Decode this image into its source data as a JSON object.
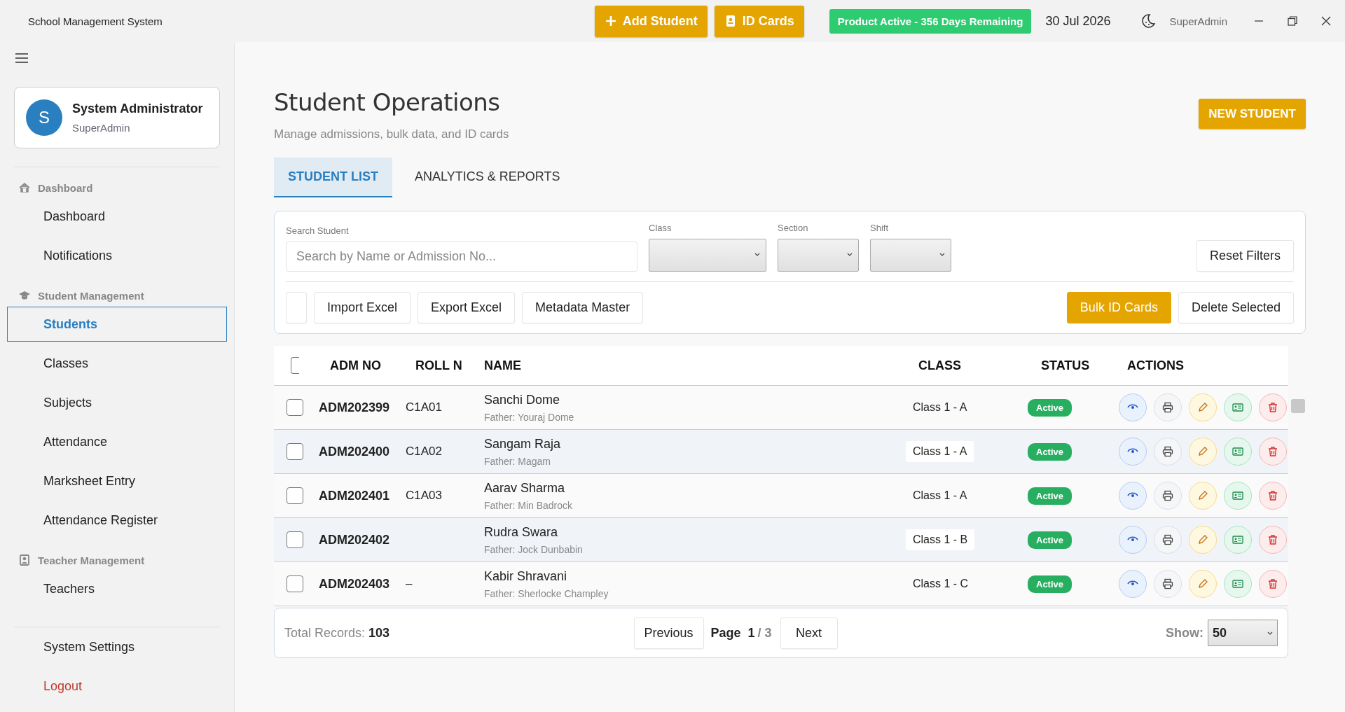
{
  "app": {
    "title": "School Management System"
  },
  "topbar": {
    "buttons": [
      {
        "kind": "add",
        "label": "Add Student"
      },
      {
        "kind": "idcard",
        "label": "ID Cards"
      }
    ],
    "license": "Product Active - 356 Days Remaining",
    "date": "30 Jul 2026",
    "user": "SuperAdmin"
  },
  "sidebar": {
    "profile": {
      "initial": "S",
      "name": "System Administrator",
      "role": "SuperAdmin"
    },
    "groups": [
      {
        "label": "Dashboard",
        "items": [
          {
            "label": "Dashboard",
            "selected": false
          },
          {
            "label": "Notifications",
            "selected": false
          }
        ]
      },
      {
        "label": "Student Management",
        "items": [
          {
            "label": "Students",
            "selected": true
          },
          {
            "label": "Classes",
            "selected": false
          },
          {
            "label": "Subjects",
            "selected": false
          },
          {
            "label": "Attendance",
            "selected": false
          },
          {
            "label": "Marksheet Entry",
            "selected": false
          },
          {
            "label": "Attendance Register",
            "selected": false
          }
        ]
      },
      {
        "label": "Teacher Management",
        "items": [
          {
            "label": "Teachers",
            "selected": false
          }
        ]
      }
    ],
    "footer": [
      {
        "kind": "normal",
        "label": "System Settings"
      },
      {
        "kind": "danger",
        "label": "Logout"
      }
    ]
  },
  "page": {
    "title": "Student Operations",
    "subtitle": "Manage admissions, bulk data, and ID cards",
    "new_button": "NEW STUDENT"
  },
  "tabs": [
    {
      "label": "STUDENT LIST",
      "selected": true
    },
    {
      "label": "ANALYTICS & REPORTS",
      "selected": false
    }
  ],
  "filters": {
    "search": {
      "label": "Search Student",
      "placeholder": "Search by Name or Admission No..."
    },
    "selects": [
      {
        "label": "Class"
      },
      {
        "label": "Section"
      },
      {
        "label": "Shift"
      }
    ],
    "reset": "Reset Filters",
    "tools": [
      "Import Excel",
      "Export Excel",
      "Metadata Master"
    ],
    "bulk_actions": [
      {
        "kind": "primary",
        "label": "Bulk ID Cards"
      },
      {
        "kind": "plain",
        "label": "Delete Selected"
      }
    ]
  },
  "table": {
    "select_all": false,
    "columns": [
      "ADM NO",
      "ROLL N",
      "NAME",
      "CLASS",
      "STATUS",
      "ACTIONS"
    ],
    "rows": [
      {
        "checked": false,
        "adm": "ADM202399",
        "roll": "C1A01",
        "name": "Sanchi Dome",
        "father": "Father: Youraj Dome",
        "class": "Class 1 - A",
        "status": "Active"
      },
      {
        "checked": false,
        "adm": "ADM202400",
        "roll": "C1A02",
        "name": "Sangam Raja",
        "father": "Father: Magam",
        "class": "Class 1 - A",
        "status": "Active"
      },
      {
        "checked": false,
        "adm": "ADM202401",
        "roll": "C1A03",
        "name": "Aarav Sharma",
        "father": "Father: Min Badrock",
        "class": "Class 1 - A",
        "status": "Active"
      },
      {
        "checked": false,
        "adm": "ADM202402",
        "name": "Rudra Swara",
        "father": "Father: Jock Dunbabin",
        "class": "Class 1 - B",
        "status": "Active"
      },
      {
        "checked": false,
        "adm": "ADM202403",
        "roll": "–",
        "name": "Kabir Shravani",
        "father": "Father: Sherlocke Champley",
        "class": "Class 1 - C",
        "status": "Active"
      }
    ]
  },
  "pager": {
    "total_label": "Total Records:",
    "total": "103",
    "previous": "Previous",
    "page_label": "Page",
    "page": "1",
    "page_total": "/ 3",
    "next": "Next",
    "show_label": "Show:",
    "page_size": "50"
  }
}
